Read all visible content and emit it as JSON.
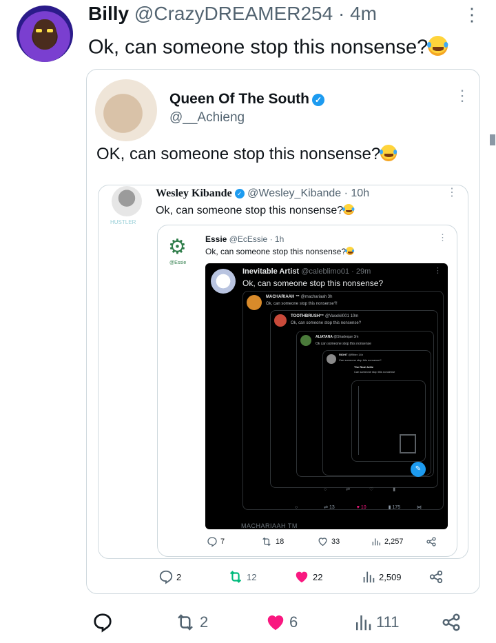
{
  "top_tweet": {
    "name": "Billy",
    "handle": "@CrazyDREAMER254",
    "separator": "·",
    "time": "4m",
    "text": "Ok, can someone stop this nonsense?",
    "actions": {
      "replies": "",
      "retweets": "2",
      "likes": "6",
      "views": "111"
    }
  },
  "quote1": {
    "name": "Queen Of The South",
    "handle": "@__Achieng",
    "text": "OK, can someone stop this nonsense?",
    "actions": {
      "replies": "2",
      "retweets": "12",
      "likes": "22",
      "views": "2,509"
    }
  },
  "quote2": {
    "name": "Wesley Kibande",
    "handle": "@Wesley_Kibande",
    "separator": "·",
    "time": "10h",
    "text": "Ok, can someone stop this nonsense?",
    "avatar_caption": "HUSTLER",
    "actions": {
      "replies": "7",
      "retweets": "18",
      "likes": "33",
      "views": "2,257"
    }
  },
  "quote3": {
    "name": "Essie",
    "handle": "@EcEssie",
    "separator": "·",
    "time": "1h",
    "text": "Ok, can someone stop this nonsense?",
    "avatar_caption": "@Essie"
  },
  "dark_screenshot": {
    "name": "Inevitable Artist",
    "handle": "@caleblimo01",
    "separator": "·",
    "time": "29m",
    "text": "Ok, can someone stop this nonsense?",
    "footer": "MACHARIAAH TM",
    "nested1": {
      "name": "MACHARIAAH ™",
      "handle": "@machariaah",
      "time": "3h",
      "text": "Ok, can someone stop this nonsense?!"
    },
    "nested2": {
      "name": "TOOTHBRUSH™",
      "handle": "@Vasekil001",
      "time": "10m",
      "text": "Ok, can someone stop this nonsense?"
    },
    "nested3": {
      "name": "ALIATANA",
      "handle": "@Shadeque",
      "time": "3m",
      "text": "Ok can someone stop this nonsense"
    },
    "nested4": {
      "name": "RIGHT",
      "handle": "@Ritter",
      "time": "14h",
      "text": "Can someone stop this nonsense?"
    },
    "nested5": {
      "name": "The Real Jollie",
      "text": "Can someone stop this nonsense"
    },
    "actions": {
      "retweets": "13",
      "likes": "10",
      "views": "175",
      "replies": ""
    }
  },
  "colors": {
    "like": "#f91880",
    "retweet": "#00ba7c",
    "verified": "#1d9bf0",
    "muted": "#536471"
  },
  "icons": [
    "more-icon",
    "verified-icon",
    "reply-icon",
    "retweet-icon",
    "heart-icon",
    "views-icon",
    "share-icon",
    "gear-icon"
  ]
}
